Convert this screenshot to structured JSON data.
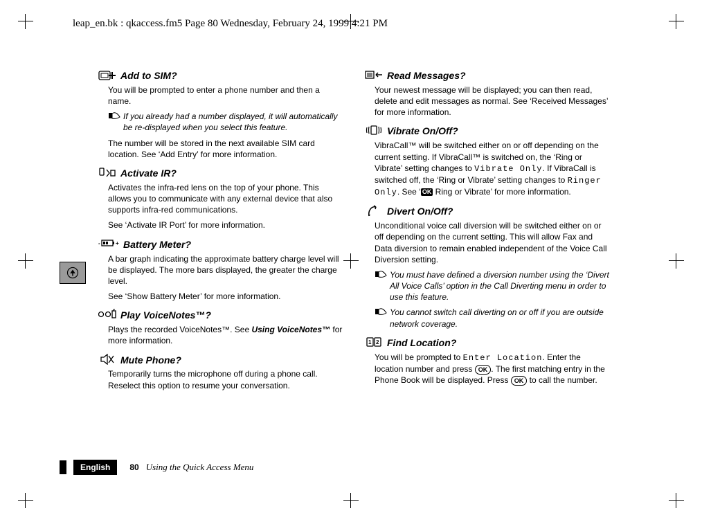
{
  "running_header": "leap_en.bk : qkaccess.fm5  Page 80  Wednesday, February 24, 1999  4:21 PM",
  "footer": {
    "language": "English",
    "page_number": "80",
    "section_title": "Using the Quick Access Menu"
  },
  "left": {
    "s1": {
      "title": "Add to SIM?",
      "p1": "You will be prompted to enter a phone number and then a name.",
      "note1": "If you already had a number displayed, it will automatically be re-displayed when you select this feature.",
      "p2": "The number will be stored in the next available SIM card location. See ‘Add Entry’ for more information."
    },
    "s2": {
      "title": "Activate IR?",
      "p1": "Activates the infra-red lens on the top of your phone. This allows you to communicate with any external device that also supports infra-red communications.",
      "p2": "See ‘Activate IR Port’ for more information."
    },
    "s3": {
      "title": "Battery Meter?",
      "p1": "A bar graph indicating the approximate battery charge level will be displayed. The more bars displayed, the greater the charge level.",
      "p2": "See ‘Show Battery Meter’ for more information."
    },
    "s4": {
      "title": "Play VoiceNotes™?",
      "p1_a": "Plays the recorded VoiceNotes™. See ",
      "p1_b": "Using VoiceNotes™",
      "p1_c": " for more information."
    },
    "s5": {
      "title": "Mute Phone?",
      "p1": "Temporarily turns the microphone off during a phone call. Reselect this option to resume your conversation."
    }
  },
  "right": {
    "s1": {
      "title": "Read Messages?",
      "p1": "Your newest message will be displayed; you can then read, delete and edit messages as normal. See ‘Received Messages’ for more information."
    },
    "s2": {
      "title": "Vibrate On/Off?",
      "p1_a": "VibraCall™ will be switched either on or off depending on the current setting. If VibraCall™ is switched on, the ‘Ring or Vibrate’ setting changes to ",
      "p1_mono1": "Vibrate Only",
      "p1_b": ". If VibraCall is switched off, the ‘Ring or Vibrate’ setting changes to ",
      "p1_mono2": "Ringer Only",
      "p1_c": ". See ‘",
      "ok_box": "OK",
      "p1_d": " Ring or Vibrate’ for more information."
    },
    "s3": {
      "title": "Divert On/Off?",
      "p1": "Unconditional voice call diversion will be switched either on or off depending on the current setting. This will allow Fax and Data diversion to remain enabled independent of the Voice Call Diversion setting.",
      "note1": "You must have defined a diversion number using the ‘Divert All Voice Calls’ option in the Call Diverting menu in order to use this feature.",
      "note2": "You cannot switch call diverting on or off if you are outside network coverage."
    },
    "s4": {
      "title": "Find Location?",
      "p1_a": "You will be prompted to ",
      "p1_mono": "Enter Location",
      "p1_b": ". Enter the location number and press ",
      "ok1": "OK",
      "p1_c": ". The first matching entry in the Phone Book will be displayed. Press ",
      "ok2": "OK",
      "p1_d": " to call the number."
    }
  }
}
